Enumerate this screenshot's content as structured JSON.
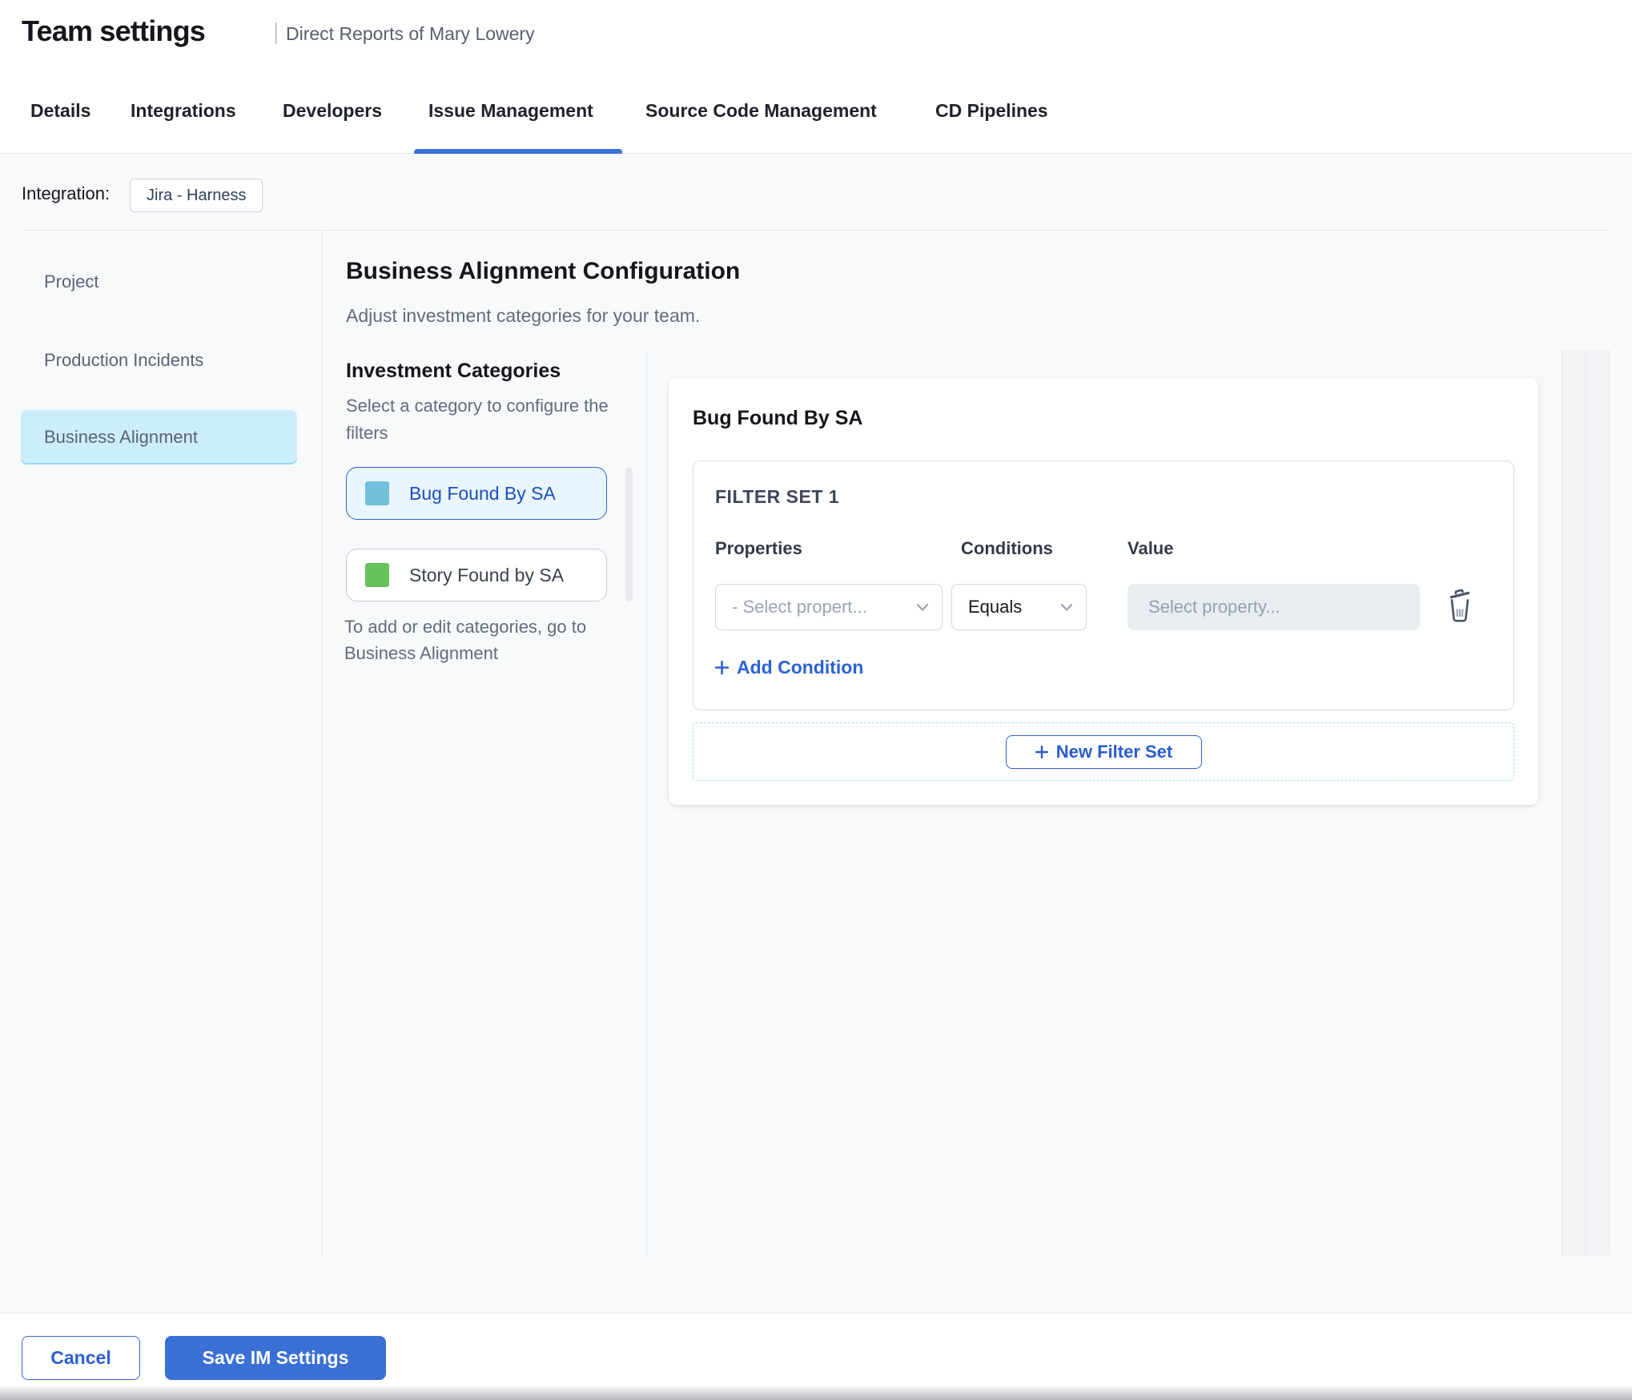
{
  "header": {
    "title": "Team settings",
    "subtitle": "Direct Reports of Mary Lowery"
  },
  "tabs": [
    {
      "label": "Details",
      "active": false
    },
    {
      "label": "Integrations",
      "active": false
    },
    {
      "label": "Developers",
      "active": false
    },
    {
      "label": "Issue Management",
      "active": true
    },
    {
      "label": "Source Code Management",
      "active": false
    },
    {
      "label": "CD Pipelines",
      "active": false
    }
  ],
  "integration": {
    "label": "Integration:",
    "chip": "Jira - Harness"
  },
  "sidebar": {
    "items": [
      {
        "label": "Project",
        "selected": false
      },
      {
        "label": "Production Incidents",
        "selected": false
      },
      {
        "label": "Business Alignment",
        "selected": true
      }
    ]
  },
  "main": {
    "heading": "Business Alignment Configuration",
    "subheading": "Adjust investment categories for your team.",
    "categories": {
      "title": "Investment Categories",
      "description": "Select a category to configure the filters",
      "items": [
        {
          "label": "Bug Found By SA",
          "color": "#72bfdc",
          "selected": true
        },
        {
          "label": "Story Found by SA",
          "color": "#67c25b",
          "selected": false
        }
      ],
      "note_line1": "To add or edit categories, go to",
      "note_line2": "Business Alignment"
    },
    "panel": {
      "title": "Bug Found By SA",
      "filter_set": {
        "label": "FILTER SET 1",
        "columns": [
          "Properties",
          "Conditions",
          "Value"
        ],
        "property_placeholder": "- Select propert...",
        "condition_value": "Equals",
        "value_placeholder": "Select property...",
        "add_condition_label": "Add Condition"
      },
      "new_filter_set_label": "New Filter Set"
    }
  },
  "footer": {
    "cancel_label": "Cancel",
    "save_label": "Save IM Settings"
  },
  "icons": {
    "chevron": "chevron-down",
    "delete": "trash",
    "add": "plus"
  },
  "colors": {
    "accent_blue": "#3a6fdb",
    "tab_underline": "#3a6fdb",
    "sidebar_selected_bg": "#cceefa",
    "bug_swatch": "#72bfdc",
    "story_swatch": "#67c25b",
    "primary_button_bg": "#3a70d6",
    "content_bg": "#f7f9fb"
  }
}
